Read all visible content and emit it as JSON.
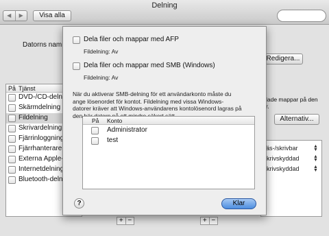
{
  "window": {
    "title": "Delning"
  },
  "toolbar": {
    "back": "◀",
    "forward": "▶",
    "show_all": "Visa alla"
  },
  "computer_name_label": "Datorns namn",
  "edit_button": "Redigera...",
  "services": {
    "header_on": "På",
    "header_service": "Tjänst",
    "items": [
      {
        "name": "DVD-/CD-delning",
        "checked": false
      },
      {
        "name": "Skärmdelning",
        "checked": false
      },
      {
        "name": "Fildelning",
        "checked": false
      },
      {
        "name": "Skrivardelning",
        "checked": false
      },
      {
        "name": "Fjärrinloggning",
        "checked": false
      },
      {
        "name": "Fjärrhanterare",
        "checked": false
      },
      {
        "name": "Externa Apple-händelser",
        "checked": false
      },
      {
        "name": "Internetdelning",
        "checked": false
      },
      {
        "name": "Bluetooth-delning",
        "checked": false
      }
    ]
  },
  "right_panel": {
    "shared_folders_text1": "lade mappar på den",
    "shared_folders_text2": "r.",
    "options_button": "Alternativ...",
    "permissions": [
      "Läs-/skrivbar",
      "Skrivskyddad",
      "Skrivskyddad"
    ]
  },
  "list_controls": {
    "plus": "+",
    "minus": "−"
  },
  "sheet": {
    "afp_label": "Dela filer och mappar med AFP",
    "afp_status": "Fildelning: Av",
    "smb_label": "Dela filer och mappar med SMB (Windows)",
    "smb_status": "Fildelning: Av",
    "description": [
      "När du aktiverar SMB-delning för ett användarkonto måste du",
      "ange lösenordet för kontot. Fildelning med vissa Windows-",
      "datorer kräver att Windows-användarens kontolösenord lagras på",
      "den här datorn på ett mindre säkert sätt."
    ],
    "accounts_header_on": "På",
    "accounts_header_account": "Konto",
    "accounts": [
      {
        "name": "Administrator",
        "checked": false
      },
      {
        "name": "test",
        "checked": false
      }
    ],
    "help": "?",
    "done_button": "Klar"
  }
}
